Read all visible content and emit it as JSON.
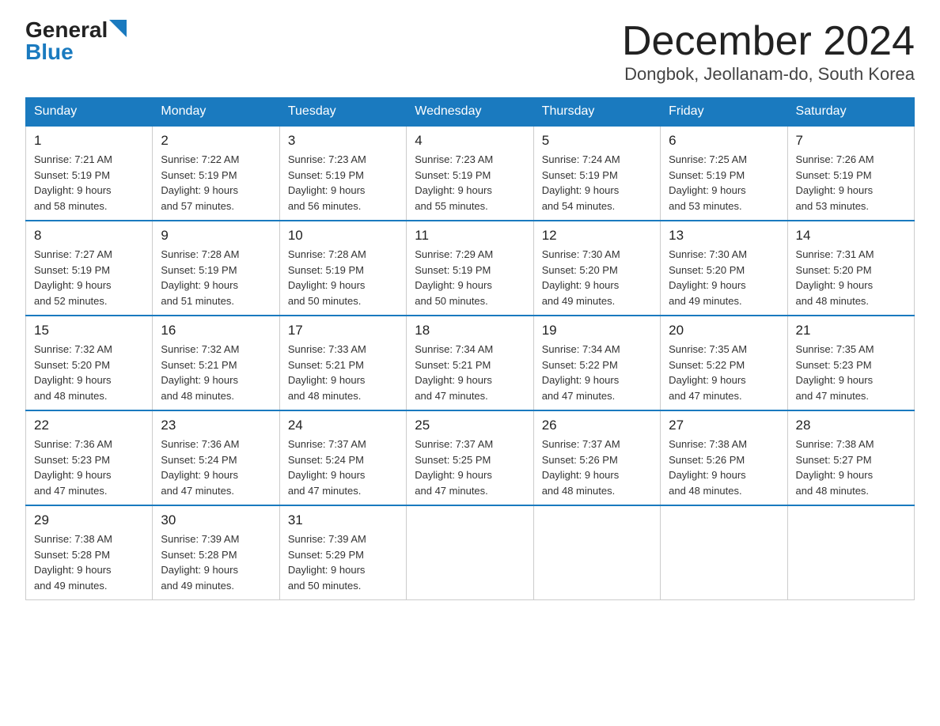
{
  "header": {
    "logo_general": "General",
    "logo_blue": "Blue",
    "title": "December 2024",
    "subtitle": "Dongbok, Jeollanam-do, South Korea"
  },
  "days_of_week": [
    "Sunday",
    "Monday",
    "Tuesday",
    "Wednesday",
    "Thursday",
    "Friday",
    "Saturday"
  ],
  "weeks": [
    [
      {
        "day": "1",
        "sunrise": "7:21 AM",
        "sunset": "5:19 PM",
        "daylight": "9 hours and 58 minutes."
      },
      {
        "day": "2",
        "sunrise": "7:22 AM",
        "sunset": "5:19 PM",
        "daylight": "9 hours and 57 minutes."
      },
      {
        "day": "3",
        "sunrise": "7:23 AM",
        "sunset": "5:19 PM",
        "daylight": "9 hours and 56 minutes."
      },
      {
        "day": "4",
        "sunrise": "7:23 AM",
        "sunset": "5:19 PM",
        "daylight": "9 hours and 55 minutes."
      },
      {
        "day": "5",
        "sunrise": "7:24 AM",
        "sunset": "5:19 PM",
        "daylight": "9 hours and 54 minutes."
      },
      {
        "day": "6",
        "sunrise": "7:25 AM",
        "sunset": "5:19 PM",
        "daylight": "9 hours and 53 minutes."
      },
      {
        "day": "7",
        "sunrise": "7:26 AM",
        "sunset": "5:19 PM",
        "daylight": "9 hours and 53 minutes."
      }
    ],
    [
      {
        "day": "8",
        "sunrise": "7:27 AM",
        "sunset": "5:19 PM",
        "daylight": "9 hours and 52 minutes."
      },
      {
        "day": "9",
        "sunrise": "7:28 AM",
        "sunset": "5:19 PM",
        "daylight": "9 hours and 51 minutes."
      },
      {
        "day": "10",
        "sunrise": "7:28 AM",
        "sunset": "5:19 PM",
        "daylight": "9 hours and 50 minutes."
      },
      {
        "day": "11",
        "sunrise": "7:29 AM",
        "sunset": "5:19 PM",
        "daylight": "9 hours and 50 minutes."
      },
      {
        "day": "12",
        "sunrise": "7:30 AM",
        "sunset": "5:20 PM",
        "daylight": "9 hours and 49 minutes."
      },
      {
        "day": "13",
        "sunrise": "7:30 AM",
        "sunset": "5:20 PM",
        "daylight": "9 hours and 49 minutes."
      },
      {
        "day": "14",
        "sunrise": "7:31 AM",
        "sunset": "5:20 PM",
        "daylight": "9 hours and 48 minutes."
      }
    ],
    [
      {
        "day": "15",
        "sunrise": "7:32 AM",
        "sunset": "5:20 PM",
        "daylight": "9 hours and 48 minutes."
      },
      {
        "day": "16",
        "sunrise": "7:32 AM",
        "sunset": "5:21 PM",
        "daylight": "9 hours and 48 minutes."
      },
      {
        "day": "17",
        "sunrise": "7:33 AM",
        "sunset": "5:21 PM",
        "daylight": "9 hours and 48 minutes."
      },
      {
        "day": "18",
        "sunrise": "7:34 AM",
        "sunset": "5:21 PM",
        "daylight": "9 hours and 47 minutes."
      },
      {
        "day": "19",
        "sunrise": "7:34 AM",
        "sunset": "5:22 PM",
        "daylight": "9 hours and 47 minutes."
      },
      {
        "day": "20",
        "sunrise": "7:35 AM",
        "sunset": "5:22 PM",
        "daylight": "9 hours and 47 minutes."
      },
      {
        "day": "21",
        "sunrise": "7:35 AM",
        "sunset": "5:23 PM",
        "daylight": "9 hours and 47 minutes."
      }
    ],
    [
      {
        "day": "22",
        "sunrise": "7:36 AM",
        "sunset": "5:23 PM",
        "daylight": "9 hours and 47 minutes."
      },
      {
        "day": "23",
        "sunrise": "7:36 AM",
        "sunset": "5:24 PM",
        "daylight": "9 hours and 47 minutes."
      },
      {
        "day": "24",
        "sunrise": "7:37 AM",
        "sunset": "5:24 PM",
        "daylight": "9 hours and 47 minutes."
      },
      {
        "day": "25",
        "sunrise": "7:37 AM",
        "sunset": "5:25 PM",
        "daylight": "9 hours and 47 minutes."
      },
      {
        "day": "26",
        "sunrise": "7:37 AM",
        "sunset": "5:26 PM",
        "daylight": "9 hours and 48 minutes."
      },
      {
        "day": "27",
        "sunrise": "7:38 AM",
        "sunset": "5:26 PM",
        "daylight": "9 hours and 48 minutes."
      },
      {
        "day": "28",
        "sunrise": "7:38 AM",
        "sunset": "5:27 PM",
        "daylight": "9 hours and 48 minutes."
      }
    ],
    [
      {
        "day": "29",
        "sunrise": "7:38 AM",
        "sunset": "5:28 PM",
        "daylight": "9 hours and 49 minutes."
      },
      {
        "day": "30",
        "sunrise": "7:39 AM",
        "sunset": "5:28 PM",
        "daylight": "9 hours and 49 minutes."
      },
      {
        "day": "31",
        "sunrise": "7:39 AM",
        "sunset": "5:29 PM",
        "daylight": "9 hours and 50 minutes."
      },
      null,
      null,
      null,
      null
    ]
  ],
  "labels": {
    "sunrise_prefix": "Sunrise: ",
    "sunset_prefix": "Sunset: ",
    "daylight_prefix": "Daylight: "
  }
}
